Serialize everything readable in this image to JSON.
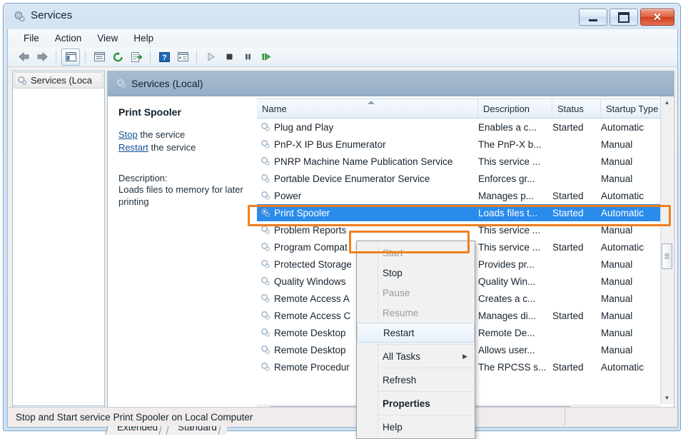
{
  "window": {
    "title": "Services",
    "icon": "services-gear-icon",
    "buttons": {
      "minimize": "Minimize",
      "maximize": "Maximize",
      "close": "Close"
    }
  },
  "menubar": {
    "items": [
      "File",
      "Action",
      "View",
      "Help"
    ]
  },
  "toolbar": {
    "items": [
      {
        "name": "back-icon",
        "glyph": "back"
      },
      {
        "name": "forward-icon",
        "glyph": "forward"
      },
      {
        "name": "show-hide-tree-icon",
        "glyph": "tree"
      },
      {
        "name": "properties-icon",
        "glyph": "props"
      },
      {
        "name": "refresh-icon",
        "glyph": "refresh"
      },
      {
        "name": "export-list-icon",
        "glyph": "export"
      },
      {
        "name": "help-icon",
        "glyph": "help"
      },
      {
        "name": "show-action-pane-icon",
        "glyph": "pane"
      },
      {
        "name": "start-service-icon",
        "glyph": "play"
      },
      {
        "name": "stop-service-icon",
        "glyph": "stop"
      },
      {
        "name": "pause-service-icon",
        "glyph": "pause"
      },
      {
        "name": "restart-service-icon",
        "glyph": "restart"
      }
    ]
  },
  "tree": {
    "root_label": "Services (Loca"
  },
  "right_pane": {
    "header": "Services (Local)",
    "header_icon": "services-gear-icon"
  },
  "detail": {
    "title": "Print Spooler",
    "stop_link": "Stop",
    "stop_suffix": " the service",
    "restart_link": "Restart",
    "restart_suffix": " the service",
    "description_label": "Description:",
    "description": "Loads files to memory for later printing"
  },
  "list": {
    "columns": [
      {
        "label": "Name",
        "sort": "asc"
      },
      {
        "label": "Description",
        "sort": ""
      },
      {
        "label": "Status",
        "sort": ""
      },
      {
        "label": "Startup Type",
        "sort": ""
      }
    ],
    "rows": [
      {
        "name": "Plug and Play",
        "description": "Enables a c...",
        "status": "Started",
        "startup": "Automatic",
        "selected": false
      },
      {
        "name": "PnP-X IP Bus Enumerator",
        "description": "The PnP-X b...",
        "status": "",
        "startup": "Manual",
        "selected": false
      },
      {
        "name": "PNRP Machine Name Publication Service",
        "description": "This service ...",
        "status": "",
        "startup": "Manual",
        "selected": false
      },
      {
        "name": "Portable Device Enumerator Service",
        "description": "Enforces gr...",
        "status": "",
        "startup": "Manual",
        "selected": false
      },
      {
        "name": "Power",
        "description": "Manages p...",
        "status": "Started",
        "startup": "Automatic",
        "selected": false
      },
      {
        "name": "Print Spooler",
        "description": "Loads files t...",
        "status": "Started",
        "startup": "Automatic",
        "selected": true
      },
      {
        "name": "Problem Reports",
        "description": "This service ...",
        "status": "",
        "startup": "Manual",
        "selected": false
      },
      {
        "name": "Program Compat",
        "description": "This service ...",
        "status": "Started",
        "startup": "Automatic",
        "selected": false
      },
      {
        "name": "Protected Storage",
        "description": "Provides pr...",
        "status": "",
        "startup": "Manual",
        "selected": false
      },
      {
        "name": "Quality Windows",
        "description": "Quality Win...",
        "status": "",
        "startup": "Manual",
        "selected": false
      },
      {
        "name": "Remote Access A",
        "description": "Creates a c...",
        "status": "",
        "startup": "Manual",
        "selected": false
      },
      {
        "name": "Remote Access C",
        "description": "Manages di...",
        "status": "Started",
        "startup": "Manual",
        "selected": false
      },
      {
        "name": "Remote Desktop",
        "description": "Remote De...",
        "status": "",
        "startup": "Manual",
        "selected": false
      },
      {
        "name": "Remote Desktop",
        "description": "Allows user...",
        "status": "",
        "startup": "Manual",
        "selected": false
      },
      {
        "name": "Remote Procedur",
        "description": "The RPCSS s...",
        "status": "Started",
        "startup": "Automatic",
        "selected": false
      }
    ]
  },
  "context_menu": {
    "items": [
      {
        "label": "Start",
        "state": "disabled",
        "submenu": false
      },
      {
        "label": "Stop",
        "state": "normal",
        "submenu": false
      },
      {
        "label": "Pause",
        "state": "disabled",
        "submenu": false
      },
      {
        "label": "Resume",
        "state": "disabled",
        "submenu": false
      },
      {
        "label": "Restart",
        "state": "hover",
        "submenu": false
      },
      {
        "label": "All Tasks",
        "state": "normal",
        "submenu": true
      },
      {
        "label": "Refresh",
        "state": "normal",
        "submenu": false
      },
      {
        "label": "Properties",
        "state": "bold",
        "submenu": false
      },
      {
        "label": "Help",
        "state": "normal",
        "submenu": false
      }
    ]
  },
  "tabs": {
    "items": [
      "Extended",
      "Standard"
    ],
    "active": "Extended"
  },
  "statusbar": {
    "text": "Stop and Start service Print Spooler on Local Computer"
  },
  "annotations": {
    "color": "#ef7f1f",
    "targets": [
      "print-spooler-row",
      "context-menu-stop-item"
    ]
  },
  "colors": {
    "selection": "#2a8bea",
    "link": "#14539a",
    "header_band": "#a0b5ca",
    "annotation": "#ef7f1f"
  }
}
